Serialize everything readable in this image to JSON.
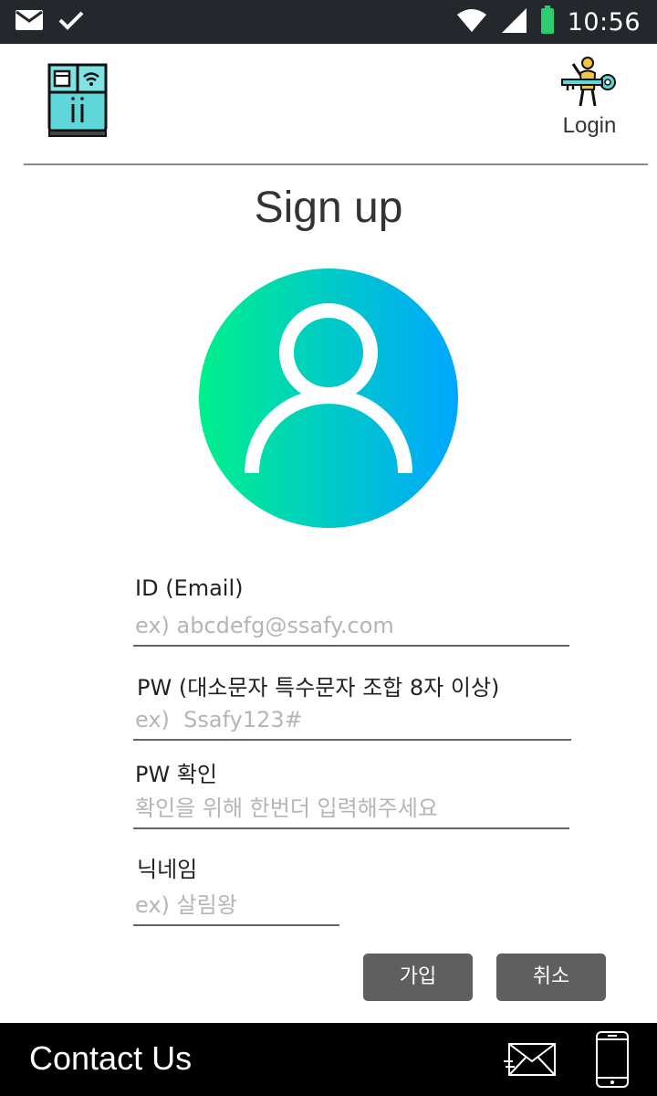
{
  "status_bar": {
    "time": "10:56",
    "icons": [
      "mail-icon",
      "check-icon",
      "wifi-icon",
      "signal-icon",
      "battery-icon"
    ]
  },
  "header": {
    "logo_icon": "smart-refrigerator-icon",
    "login_label": "Login",
    "login_icon": "person-key-icon"
  },
  "page": {
    "title": "Sign up",
    "avatar_icon": "user-profile-icon",
    "avatar_gradient": [
      "#00f08c",
      "#00a6ff"
    ]
  },
  "form": {
    "id": {
      "label": "ID (Email)",
      "placeholder": "ex) abcdefg@ssafy.com",
      "value": ""
    },
    "pw": {
      "label": "PW (대소문자 특수문자 조합 8자 이상)",
      "placeholder": "ex)  Ssafy123#",
      "value": ""
    },
    "pw_confirm": {
      "label": "PW 확인",
      "placeholder": "확인을 위해 한번더 입력해주세요",
      "value": ""
    },
    "nickname": {
      "label": "닉네임",
      "placeholder": "ex) 살림왕",
      "value": ""
    },
    "submit_label": "가입",
    "cancel_label": "취소"
  },
  "footer": {
    "contact_label": "Contact Us",
    "icons": [
      "envelope-icon",
      "phone-icon"
    ]
  },
  "colors": {
    "status_bar": "#24272b",
    "button": "#5f5f5f",
    "footer": "#000000"
  }
}
